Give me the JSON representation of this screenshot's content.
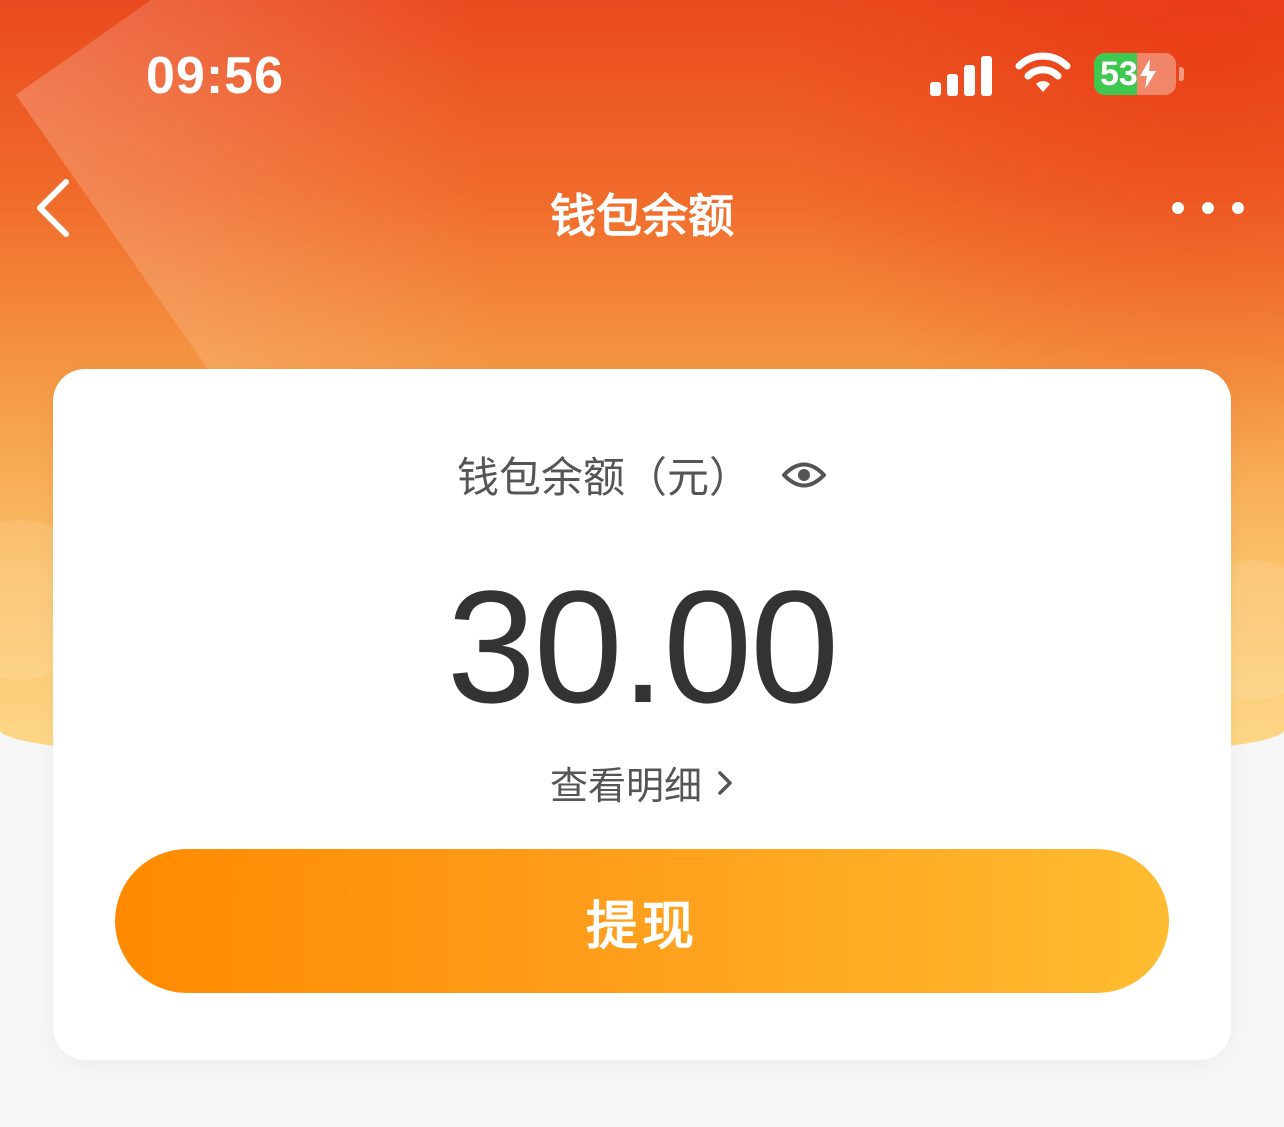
{
  "status_bar": {
    "time": "09:56",
    "battery_level": "53",
    "icons": [
      "cellular-signal-icon",
      "wifi-icon",
      "battery-charging-icon"
    ]
  },
  "nav": {
    "title": "钱包余额",
    "back_icon": "chevron-left-icon",
    "more_icon": "more-dots-icon"
  },
  "card": {
    "label": "钱包余额（元）",
    "visibility_icon": "eye-icon",
    "amount": "30.00",
    "details_link": "查看明细",
    "details_icon": "chevron-right-icon",
    "withdraw_button": "提现"
  },
  "colors": {
    "header_top": "#ea4a1f",
    "header_bottom": "#fdd98a",
    "button_start": "#ff8a00",
    "button_end": "#ffbc30",
    "battery_green": "#3ec84f"
  }
}
